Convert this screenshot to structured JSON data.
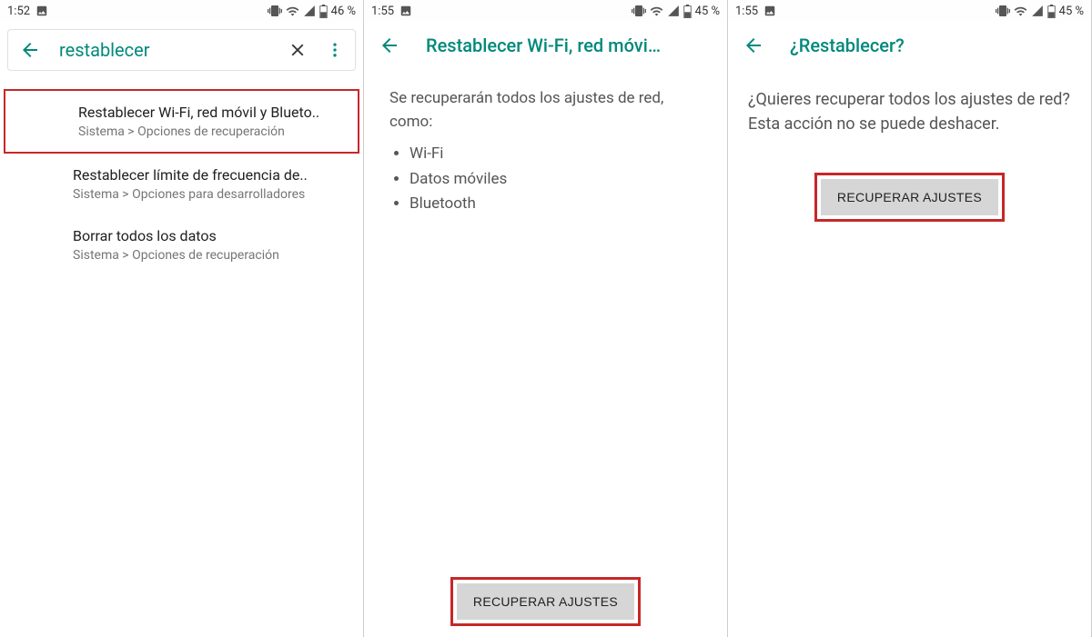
{
  "screen1": {
    "status": {
      "time": "1:52",
      "battery": "46 %"
    },
    "search": {
      "query": "restablecer"
    },
    "results": [
      {
        "title": "Restablecer Wi-Fi, red móvil y Blueto..",
        "path": "Sistema > Opciones de recuperación",
        "highlight": true
      },
      {
        "title": "Restablecer límite de frecuencia de..",
        "path": "Sistema > Opciones para desarrolladores",
        "highlight": false
      },
      {
        "title": "Borrar todos los datos",
        "path": "Sistema > Opciones de recuperación",
        "highlight": false
      }
    ]
  },
  "screen2": {
    "status": {
      "time": "1:55",
      "battery": "45 %"
    },
    "title": "Restablecer Wi-Fi, red móvi…",
    "intro": "Se recuperarán todos los ajustes de red, como:",
    "bullets": [
      "Wi-Fi",
      "Datos móviles",
      "Bluetooth"
    ],
    "button": "RECUPERAR AJUSTES"
  },
  "screen3": {
    "status": {
      "time": "1:55",
      "battery": "45 %"
    },
    "title": "¿Restablecer?",
    "body": "¿Quieres recuperar todos los ajustes de red? Esta acción no se puede deshacer.",
    "button": "RECUPERAR AJUSTES"
  }
}
